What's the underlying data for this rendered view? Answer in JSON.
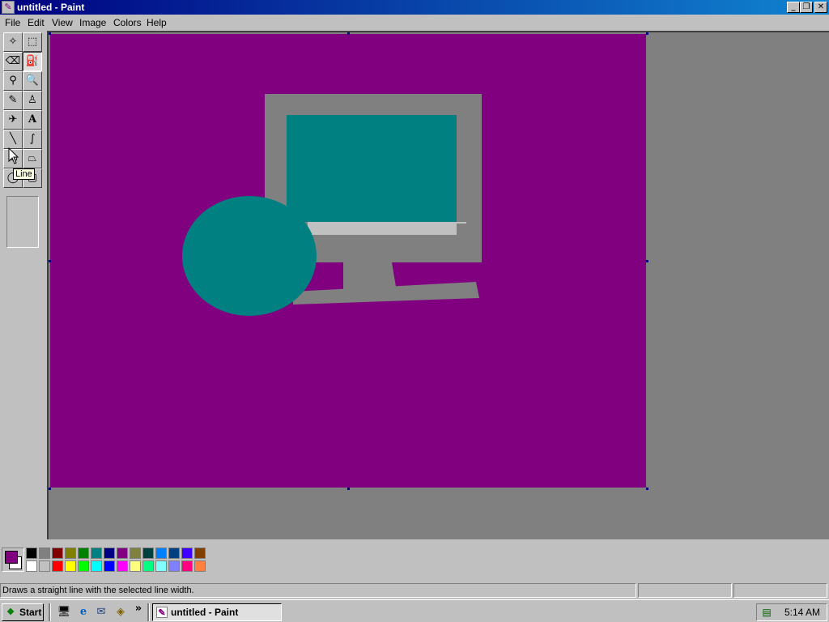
{
  "window": {
    "title": "untitled - Paint",
    "controls": {
      "minimize": "_",
      "maximize": "❐",
      "close": "✕"
    }
  },
  "menu": [
    "File",
    "Edit",
    "View",
    "Image",
    "Colors",
    "Help"
  ],
  "toolbox": {
    "tools": [
      {
        "name": "free-form-select",
        "icon": "✧"
      },
      {
        "name": "rect-select",
        "icon": "⬚"
      },
      {
        "name": "eraser",
        "icon": "⌫"
      },
      {
        "name": "fill-with-color",
        "icon": "⛽"
      },
      {
        "name": "pick-color",
        "icon": "⚲"
      },
      {
        "name": "magnifier",
        "icon": "🔍"
      },
      {
        "name": "pencil",
        "icon": "✎"
      },
      {
        "name": "brush",
        "icon": "♙"
      },
      {
        "name": "airbrush",
        "icon": "✈"
      },
      {
        "name": "text",
        "icon": "A"
      },
      {
        "name": "line",
        "icon": "╲"
      },
      {
        "name": "curve",
        "icon": "∫"
      },
      {
        "name": "rectangle",
        "icon": "▭"
      },
      {
        "name": "polygon",
        "icon": "⏢"
      },
      {
        "name": "ellipse",
        "icon": "◯"
      },
      {
        "name": "rounded-rectangle",
        "icon": "▢"
      }
    ],
    "tooltip": "Line"
  },
  "canvas": {
    "background": "#800080",
    "shapes_colors": {
      "monitor": "#808080",
      "screen": "#008080",
      "stand_light": "#c0c0c0",
      "ellipse": "#008080"
    }
  },
  "palette": {
    "foreground": "#800080",
    "background": "#ffffff",
    "top_row": [
      "#000000",
      "#808080",
      "#800000",
      "#808000",
      "#008000",
      "#008080",
      "#000080",
      "#800080",
      "#808040",
      "#004040",
      "#0080ff",
      "#004080",
      "#4000ff",
      "#804000"
    ],
    "bottom_row": [
      "#ffffff",
      "#c0c0c0",
      "#ff0000",
      "#ffff00",
      "#00ff00",
      "#00ffff",
      "#0000ff",
      "#ff00ff",
      "#ffff80",
      "#00ff80",
      "#80ffff",
      "#8080ff",
      "#ff0080",
      "#ff8040"
    ]
  },
  "status": {
    "message": "Draws a straight line with the selected line width.",
    "coords": "",
    "size": ""
  },
  "taskbar": {
    "start_label": "Start",
    "task_label": "untitled - Paint",
    "chevron": "»",
    "clock": "5:14 AM",
    "quicklaunch": [
      {
        "name": "show-desktop-icon",
        "glyph": "🖥"
      },
      {
        "name": "internet-explorer-icon",
        "glyph": "e"
      },
      {
        "name": "outlook-express-icon",
        "glyph": "✉"
      },
      {
        "name": "channels-icon",
        "glyph": "◈"
      }
    ]
  }
}
